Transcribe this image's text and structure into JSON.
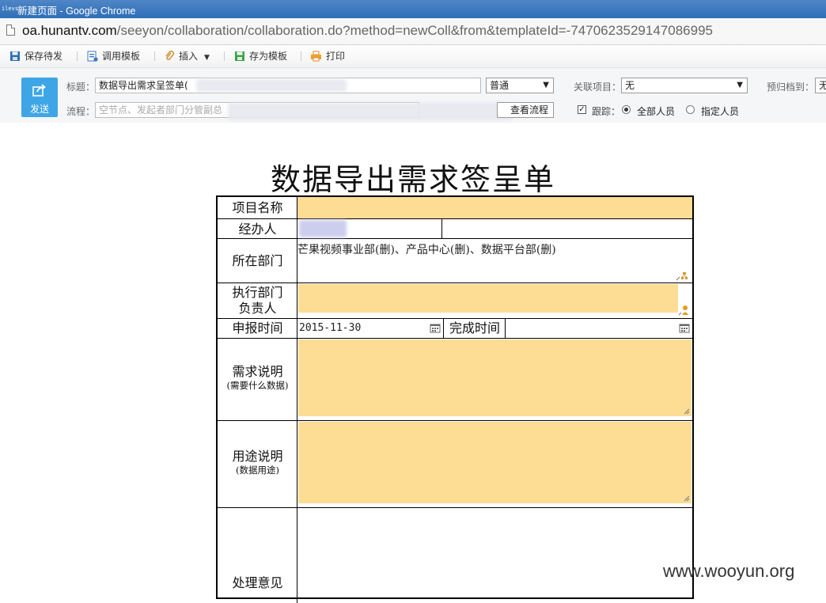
{
  "window": {
    "title": "新建页面 - Google Chrome",
    "favicon_text": "ilevs"
  },
  "address": {
    "url_host": "oa.hunantv.com",
    "url_path": "/seeyon/collaboration/collaboration.do?method=newColl&from&templateId=-7470623529147086995"
  },
  "toolbar": {
    "save_draft": "保存待发",
    "use_template": "调用模板",
    "insert": "插入",
    "save_template": "存为模板",
    "print": "打印"
  },
  "header": {
    "send_label": "发送",
    "subject_label": "标题：",
    "subject_value": "数据导出需求呈签单(",
    "priority_value": "普通",
    "related_label": "关联项目：",
    "related_value": "无",
    "archive_label": "预归档到：",
    "archive_value": "无",
    "flow_label": "流程：",
    "flow_placeholder": "空节点、发起者部门分管副总",
    "view_flow": "查看流程",
    "track_label": "跟踪：",
    "all_people": "全部人员",
    "specified_people": "指定人员"
  },
  "form": {
    "title": "数据导出需求签呈单",
    "project_name_label": "项目名称",
    "handler_label": "经办人",
    "department_label": "所在部门",
    "department_value": "芒果视频事业部(删)、产品中心(删)、数据平台部(删)",
    "exec_dept_label_1": "执行部门",
    "exec_dept_label_2": "负责人",
    "report_time_label": "申报时间",
    "report_time_value": "2015-11-30",
    "complete_time_label": "完成时间",
    "requirement_label": "需求说明",
    "requirement_sub": "(需要什么数据)",
    "usage_label": "用途说明",
    "usage_sub": "(数据用途)",
    "opinion_label": "处理意见"
  },
  "watermark": "www.wooyun.org"
}
